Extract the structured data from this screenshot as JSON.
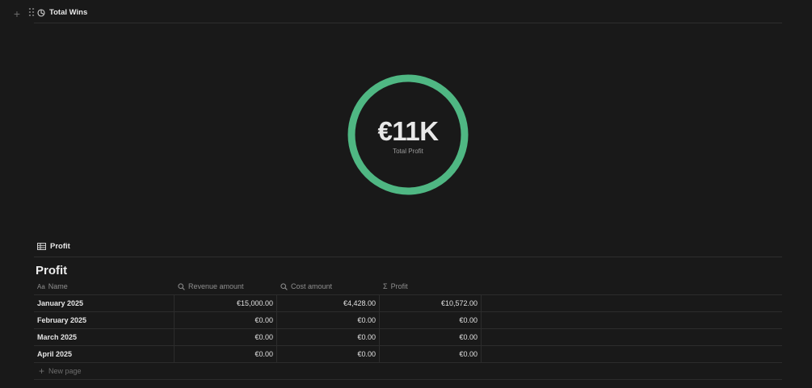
{
  "chart_block": {
    "title": "Total Wins"
  },
  "chart_data": {
    "type": "pie",
    "title": "",
    "center_value": "€11K",
    "center_label": "Total Profit",
    "values": [
      1
    ],
    "color": "#4fb783"
  },
  "table_block": {
    "view_label": "Profit",
    "title": "Profit",
    "columns": [
      {
        "label": "Name",
        "icon": "text-icon"
      },
      {
        "label": "Revenue amount",
        "icon": "search-icon"
      },
      {
        "label": "Cost amount",
        "icon": "search-icon"
      },
      {
        "label": "Profit",
        "icon": "sigma-icon"
      }
    ],
    "rows": [
      {
        "name": "January 2025",
        "revenue": "€15,000.00",
        "cost": "€4,428.00",
        "profit": "€10,572.00"
      },
      {
        "name": "February 2025",
        "revenue": "€0.00",
        "cost": "€0.00",
        "profit": "€0.00"
      },
      {
        "name": "March 2025",
        "revenue": "€0.00",
        "cost": "€0.00",
        "profit": "€0.00"
      },
      {
        "name": "April 2025",
        "revenue": "€0.00",
        "cost": "€0.00",
        "profit": "€0.00"
      }
    ],
    "new_page_label": "New page"
  }
}
